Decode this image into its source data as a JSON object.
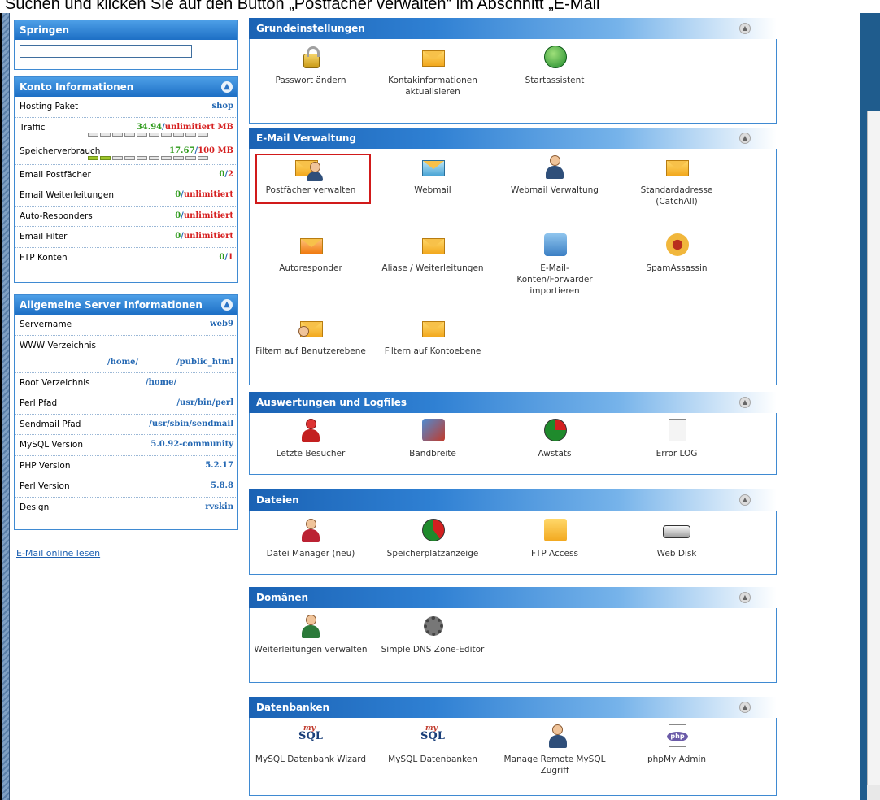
{
  "caption": "Suchen und klicken Sie auf den Button „Postfächer verwalten“ im Abschnitt „E-Mail",
  "sidebar": {
    "springen": {
      "title": "Springen",
      "input_value": ""
    },
    "konto": {
      "title": "Konto Informationen",
      "rows": [
        {
          "label": "Hosting Paket",
          "value": "shop"
        },
        {
          "label": "Traffic",
          "used": "34.94",
          "sep": "/",
          "limit": "unlimitiert MB",
          "bar_filled": 0
        },
        {
          "label": "Speicherverbrauch",
          "used": "17.67",
          "sep": "/",
          "limit": "100 MB",
          "bar_filled": 0.176
        },
        {
          "label": "Email Postfächer",
          "used": "0",
          "sep": "/",
          "limit": "2"
        },
        {
          "label": "Email Weiterleitungen",
          "used": "0",
          "sep": "/",
          "limit": "unlimitiert"
        },
        {
          "label": "Auto-Responders",
          "used": "0",
          "sep": "/",
          "limit": "unlimitiert"
        },
        {
          "label": "Email Filter",
          "used": "0",
          "sep": "/",
          "limit": "unlimitiert"
        },
        {
          "label": "FTP Konten",
          "used": "0",
          "sep": "/",
          "limit": "1"
        }
      ]
    },
    "server": {
      "title": "Allgemeine Server Informationen",
      "rows": [
        {
          "label": "Servername",
          "value": "web9"
        },
        {
          "label": "WWW Verzeichnis",
          "value_a": "/home/",
          "value_b": "/public_html"
        },
        {
          "label": "Root Verzeichnis",
          "value": "/home/"
        },
        {
          "label": "Perl Pfad",
          "value": "/usr/bin/perl"
        },
        {
          "label": "Sendmail Pfad",
          "value": "/usr/sbin/sendmail"
        },
        {
          "label": "MySQL Version",
          "value": "5.0.92-community"
        },
        {
          "label": "PHP Version",
          "value": "5.2.17"
        },
        {
          "label": "Perl Version",
          "value": "5.8.8"
        },
        {
          "label": "Design",
          "value": "rvskin"
        }
      ]
    },
    "mail_link": "E-Mail online lesen"
  },
  "panels": {
    "grund": {
      "title": "Grundeinstellungen",
      "items": [
        "Passwort ändern",
        "Kontakinformationen aktualisieren",
        "Startassistent"
      ]
    },
    "email": {
      "title": "E-Mail Verwaltung",
      "items": [
        "Postfächer verwalten",
        "Webmail",
        "Webmail Verwaltung",
        "Standardadresse (CatchAll)",
        "Autoresponder",
        "Aliase / Weiterleitungen",
        "E-Mail-Konten/Forwarder importieren",
        "SpamAssassin",
        "Filtern auf Benutzerebene",
        "Filtern auf Kontoebene"
      ]
    },
    "logs": {
      "title": "Auswertungen und Logfiles",
      "items": [
        "Letzte Besucher",
        "Bandbreite",
        "Awstats",
        "Error LOG"
      ]
    },
    "dateien": {
      "title": "Dateien",
      "items": [
        "Datei Manager (neu)",
        "Speicherplatzanzeige",
        "FTP Access",
        "Web Disk"
      ]
    },
    "domaenen": {
      "title": "Domänen",
      "items": [
        "Weiterleitungen verwalten",
        "Simple DNS Zone-Editor"
      ]
    },
    "db": {
      "title": "Datenbanken",
      "items": [
        "MySQL Datenbank Wizard",
        "MySQL Datenbanken",
        "Manage Remote MySQL Zugriff",
        "phpMy Admin"
      ]
    }
  },
  "icon_text": {
    "sql": "SQL",
    "sql_my": "my",
    "php": "php"
  },
  "colors": {
    "header_blue": "#1d6fc5",
    "value_green": "#2d9a1a",
    "value_red": "#d62020",
    "highlight_red": "#d11a1a"
  }
}
